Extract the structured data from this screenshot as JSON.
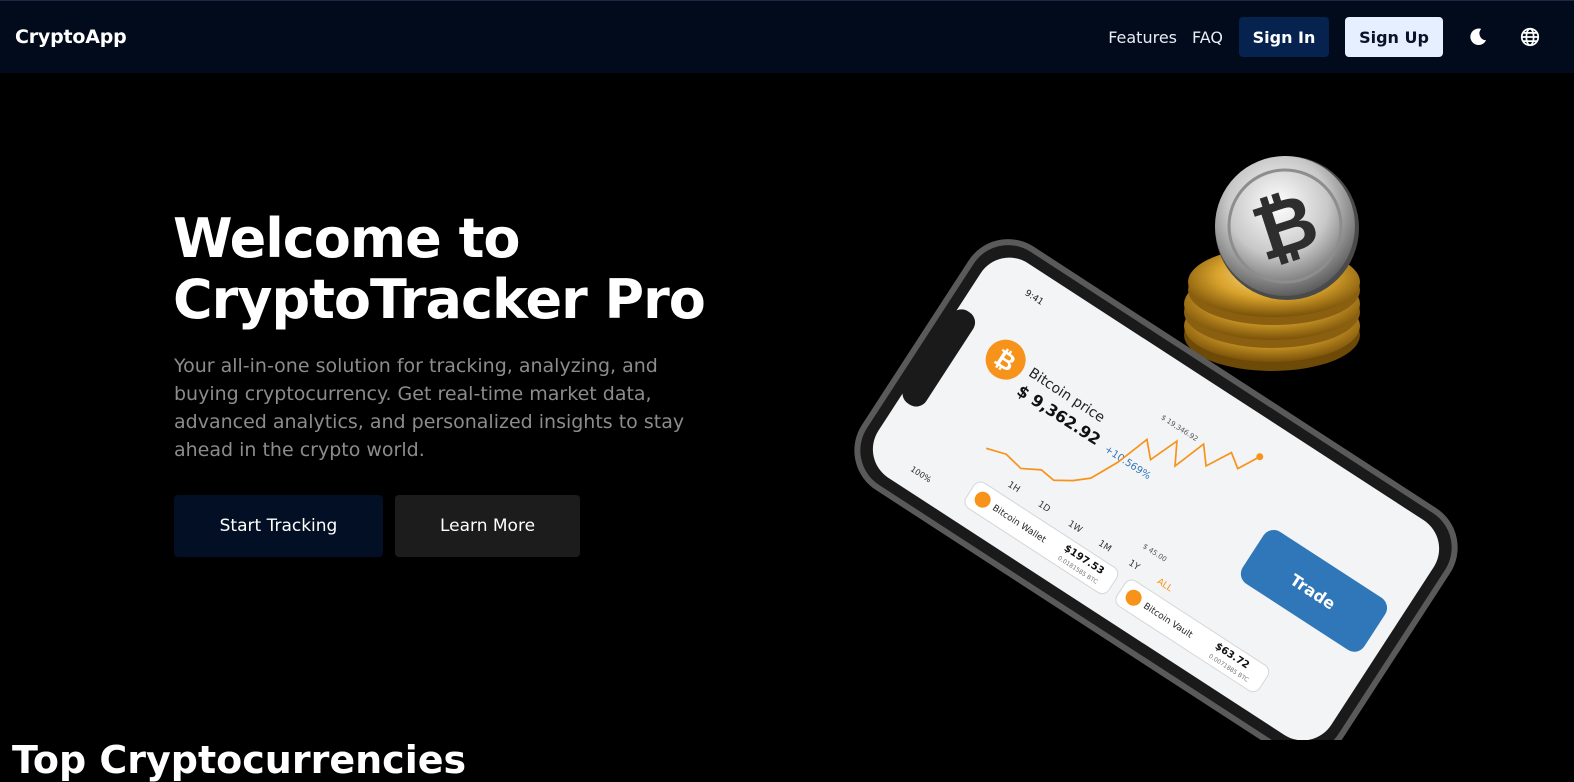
{
  "navbar": {
    "brand": "CryptoApp",
    "links": [
      "Features",
      "FAQ"
    ],
    "sign_in_label": "Sign In",
    "sign_up_label": "Sign Up",
    "theme_icon": "moon-icon",
    "language_icon": "globe-icon"
  },
  "hero": {
    "title_line1": "Welcome to",
    "title_line2": "CryptoTracker Pro",
    "description": "Your all-in-one solution for tracking, analyzing, and buying cryptocurrency. Get real-time market data, advanced analytics, and personalized insights to stay ahead in the crypto world.",
    "primary_button": "Start Tracking",
    "secondary_button": "Learn More"
  },
  "phone_screen": {
    "time": "9:41",
    "battery": "100%",
    "heading": "Bitcoin price",
    "price": "$ 9,362.92",
    "change": "+10.569%",
    "chart_high": "$ 19,346.92",
    "chart_low": "$ 45.00",
    "time_ranges": [
      "1H",
      "1D",
      "1W",
      "1M",
      "1Y",
      "ALL"
    ],
    "wallets": [
      {
        "name": "Bitcoin Wallet",
        "value": "$197.53",
        "amount": "0.0181585 BTC"
      },
      {
        "name": "Bitcoin Vault",
        "value": "$63.72",
        "amount": "0.0071885 BTC"
      }
    ],
    "trade_label": "Trade"
  },
  "colors": {
    "navbar_bg": "#020b1c",
    "sign_in_bg": "#062350",
    "sign_up_bg": "#e6efff",
    "accent_orange": "#f7931a",
    "trade_blue": "#2f77b8"
  },
  "next_section": {
    "heading_partial": "Top Cryptocurrencies"
  }
}
